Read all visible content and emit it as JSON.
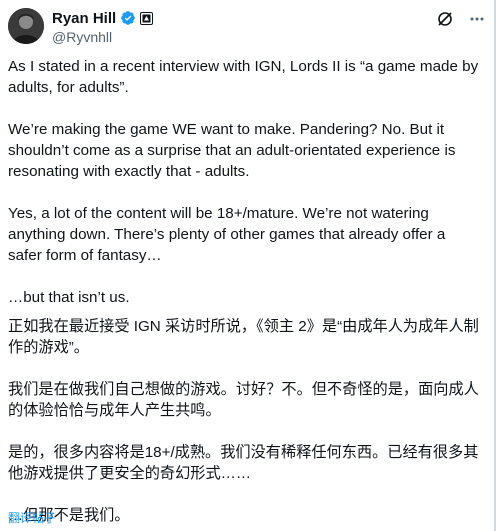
{
  "author": {
    "name": "Ryan Hill",
    "handle": "@Ryvnhll",
    "verified_color": "#1d9bf0"
  },
  "icons": {
    "verified": "verified-badge-icon",
    "affiliation": "affiliate-badge-icon",
    "grok": "grok-icon",
    "more": "more-options-icon"
  },
  "post": {
    "en": [
      "As I stated in a recent interview with IGN, Lords II is “a game made by adults, for adults”.",
      "We’re making the game WE want to make. Pandering? No. But it shouldn’t come as a surprise that an adult-orientated experience is resonating with exactly that - adults.",
      "Yes, a lot of the content will be 18+/mature. We’re not watering anything down. There’s plenty of other games that already offer a safer form of fantasy…",
      "…but that isn’t us."
    ],
    "zh": [
      "正如我在最近接受 IGN 采访时所说，《领主 2》是“由成年人为成年人制作的游戏”。",
      "我们是在做我们自己想做的游戏。讨好？不。但不奇怪的是，面向成人的体验恰恰与成年人产生共鸣。",
      "是的，很多内容将是18+/成熟。我们没有稀释任何东西。已经有很多其他游戏提供了更安全的奇幻形式……",
      "…但那不是我们。"
    ]
  },
  "translate_label": "翻译帖子"
}
